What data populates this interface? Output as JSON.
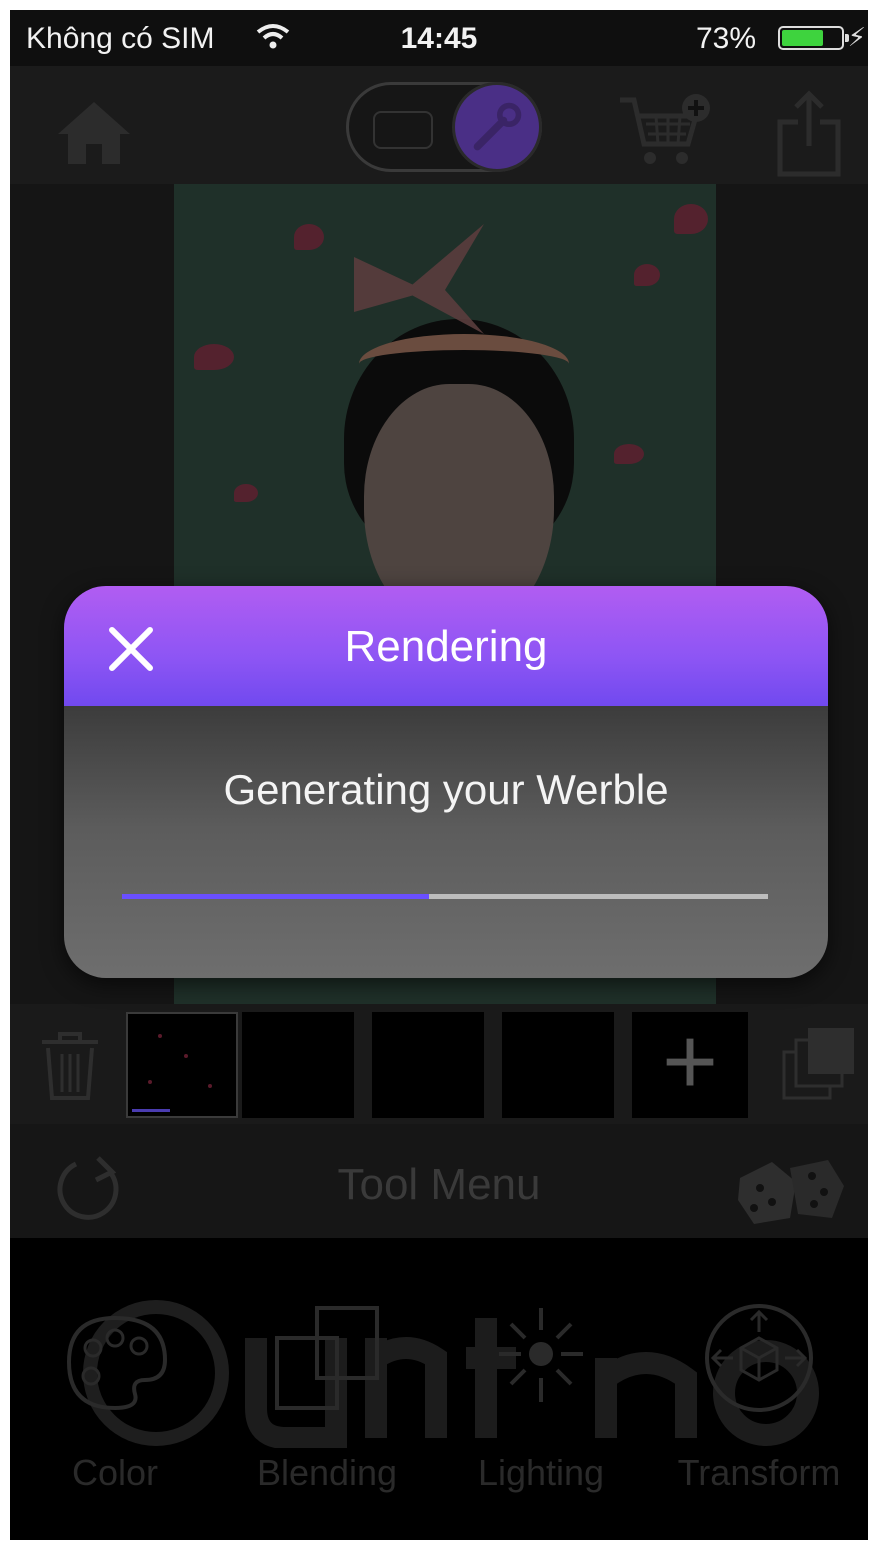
{
  "status_bar": {
    "carrier": "Không có SIM",
    "time": "14:45",
    "battery_percent": "73%",
    "battery_level": 0.73,
    "icons": [
      "wifi-icon",
      "battery-icon",
      "charging-bolt-icon"
    ]
  },
  "toolbar": {
    "icons": [
      "home-icon",
      "grid-icon",
      "wrench-icon",
      "add-to-cart-icon",
      "share-icon"
    ],
    "mode_toggle": "wrench"
  },
  "filmstrip": {
    "icons": [
      "trash-icon",
      "add-icon",
      "layers-icon"
    ],
    "plus_glyph": "+"
  },
  "tool_menu": {
    "title": "Tool Menu",
    "icons": [
      "redo-icon",
      "dice-icon"
    ]
  },
  "tools": [
    {
      "label": "Color",
      "icon": "palette-icon"
    },
    {
      "label": "Blending",
      "icon": "blending-icon"
    },
    {
      "label": "Lighting",
      "icon": "lighting-icon"
    },
    {
      "label": "Transform",
      "icon": "transform-icon"
    }
  ],
  "dialog": {
    "title": "Rendering",
    "message": "Generating your Werble",
    "progress": 0.475,
    "close_icon": "close-icon"
  },
  "colors": {
    "dialog_header_top": "#b15df2",
    "dialog_header_bottom": "#7149ef",
    "progress_fill": "#6a4fff",
    "progress_track": "#bdbdbd",
    "battery_green": "#3ed33e"
  }
}
